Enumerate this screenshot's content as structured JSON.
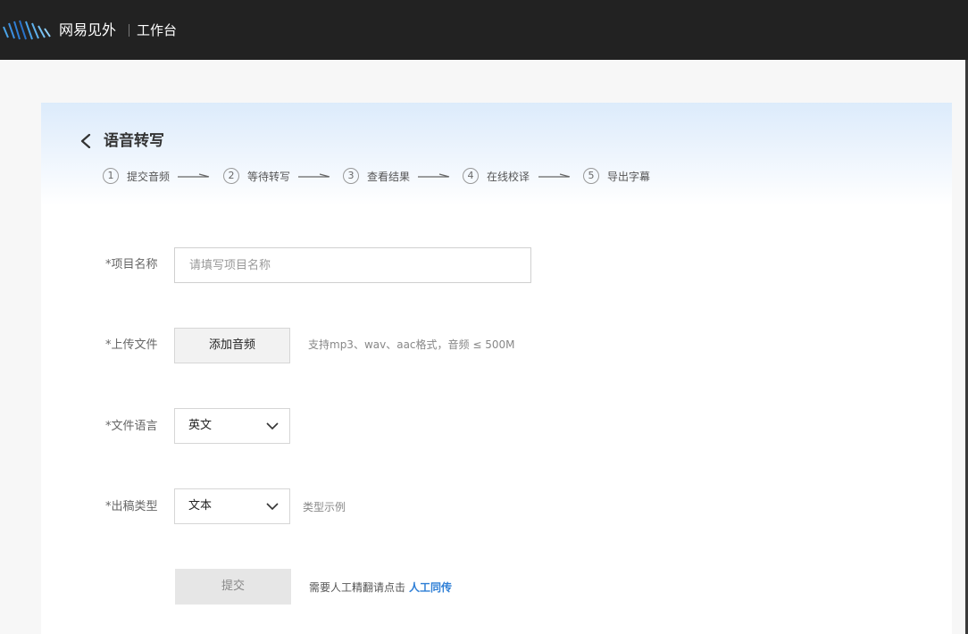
{
  "header": {
    "brand": "网易见外",
    "workspace": "工作台"
  },
  "page": {
    "title": "语音转写"
  },
  "steps": [
    {
      "num": "1",
      "label": "提交音频"
    },
    {
      "num": "2",
      "label": "等待转写"
    },
    {
      "num": "3",
      "label": "查看结果"
    },
    {
      "num": "4",
      "label": "在线校译"
    },
    {
      "num": "5",
      "label": "导出字幕"
    }
  ],
  "form": {
    "project_name": {
      "label": "*项目名称",
      "placeholder": "请填写项目名称",
      "value": ""
    },
    "upload": {
      "label": "*上传文件",
      "button": "添加音频",
      "hint": "支持mp3、wav、aac格式，音频 ≤ 500M"
    },
    "language": {
      "label": "*文件语言",
      "value": "英文"
    },
    "output_type": {
      "label": "*出稿类型",
      "value": "文本",
      "example_link": "类型示例"
    },
    "submit": {
      "button": "提交",
      "note": "需要人工精翻请点击",
      "link": "人工同传"
    }
  },
  "colors": {
    "topbar": "#222222",
    "link": "#2f7fd6",
    "card_gradient_top": "#dcebfb"
  }
}
